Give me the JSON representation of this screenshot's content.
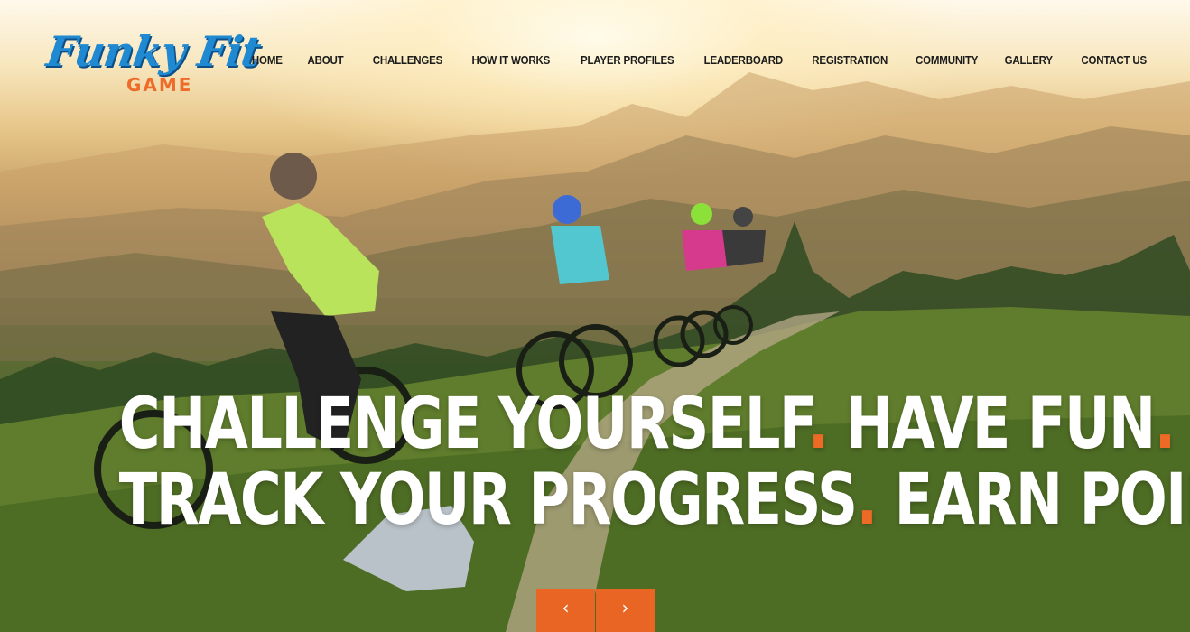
{
  "brand": {
    "logo_script": "Funky Fit",
    "logo_sub": "GAME",
    "colors": {
      "primary_blue": "#1f8ad2",
      "accent_orange": "#ec6a25"
    }
  },
  "nav": {
    "items": [
      "HOME",
      "ABOUT",
      "CHALLENGES",
      "HOW IT WORKS",
      "PLAYER PROFILES",
      "LEADERBOARD",
      "REGISTRATION",
      "COMMUNITY",
      "GALLERY",
      "CONTACT US"
    ]
  },
  "hero": {
    "line1_a": "CHALLENGE YOURSELF",
    "line1_b": "HAVE FUN",
    "line2_a": "TRACK YOUR PROGRESS",
    "line2_b": "EARN POINTS",
    "dot": "."
  },
  "slider": {
    "prev_icon": "chevron-left-icon",
    "next_icon": "chevron-right-icon",
    "prev_glyph": "‹",
    "next_glyph": "›"
  }
}
